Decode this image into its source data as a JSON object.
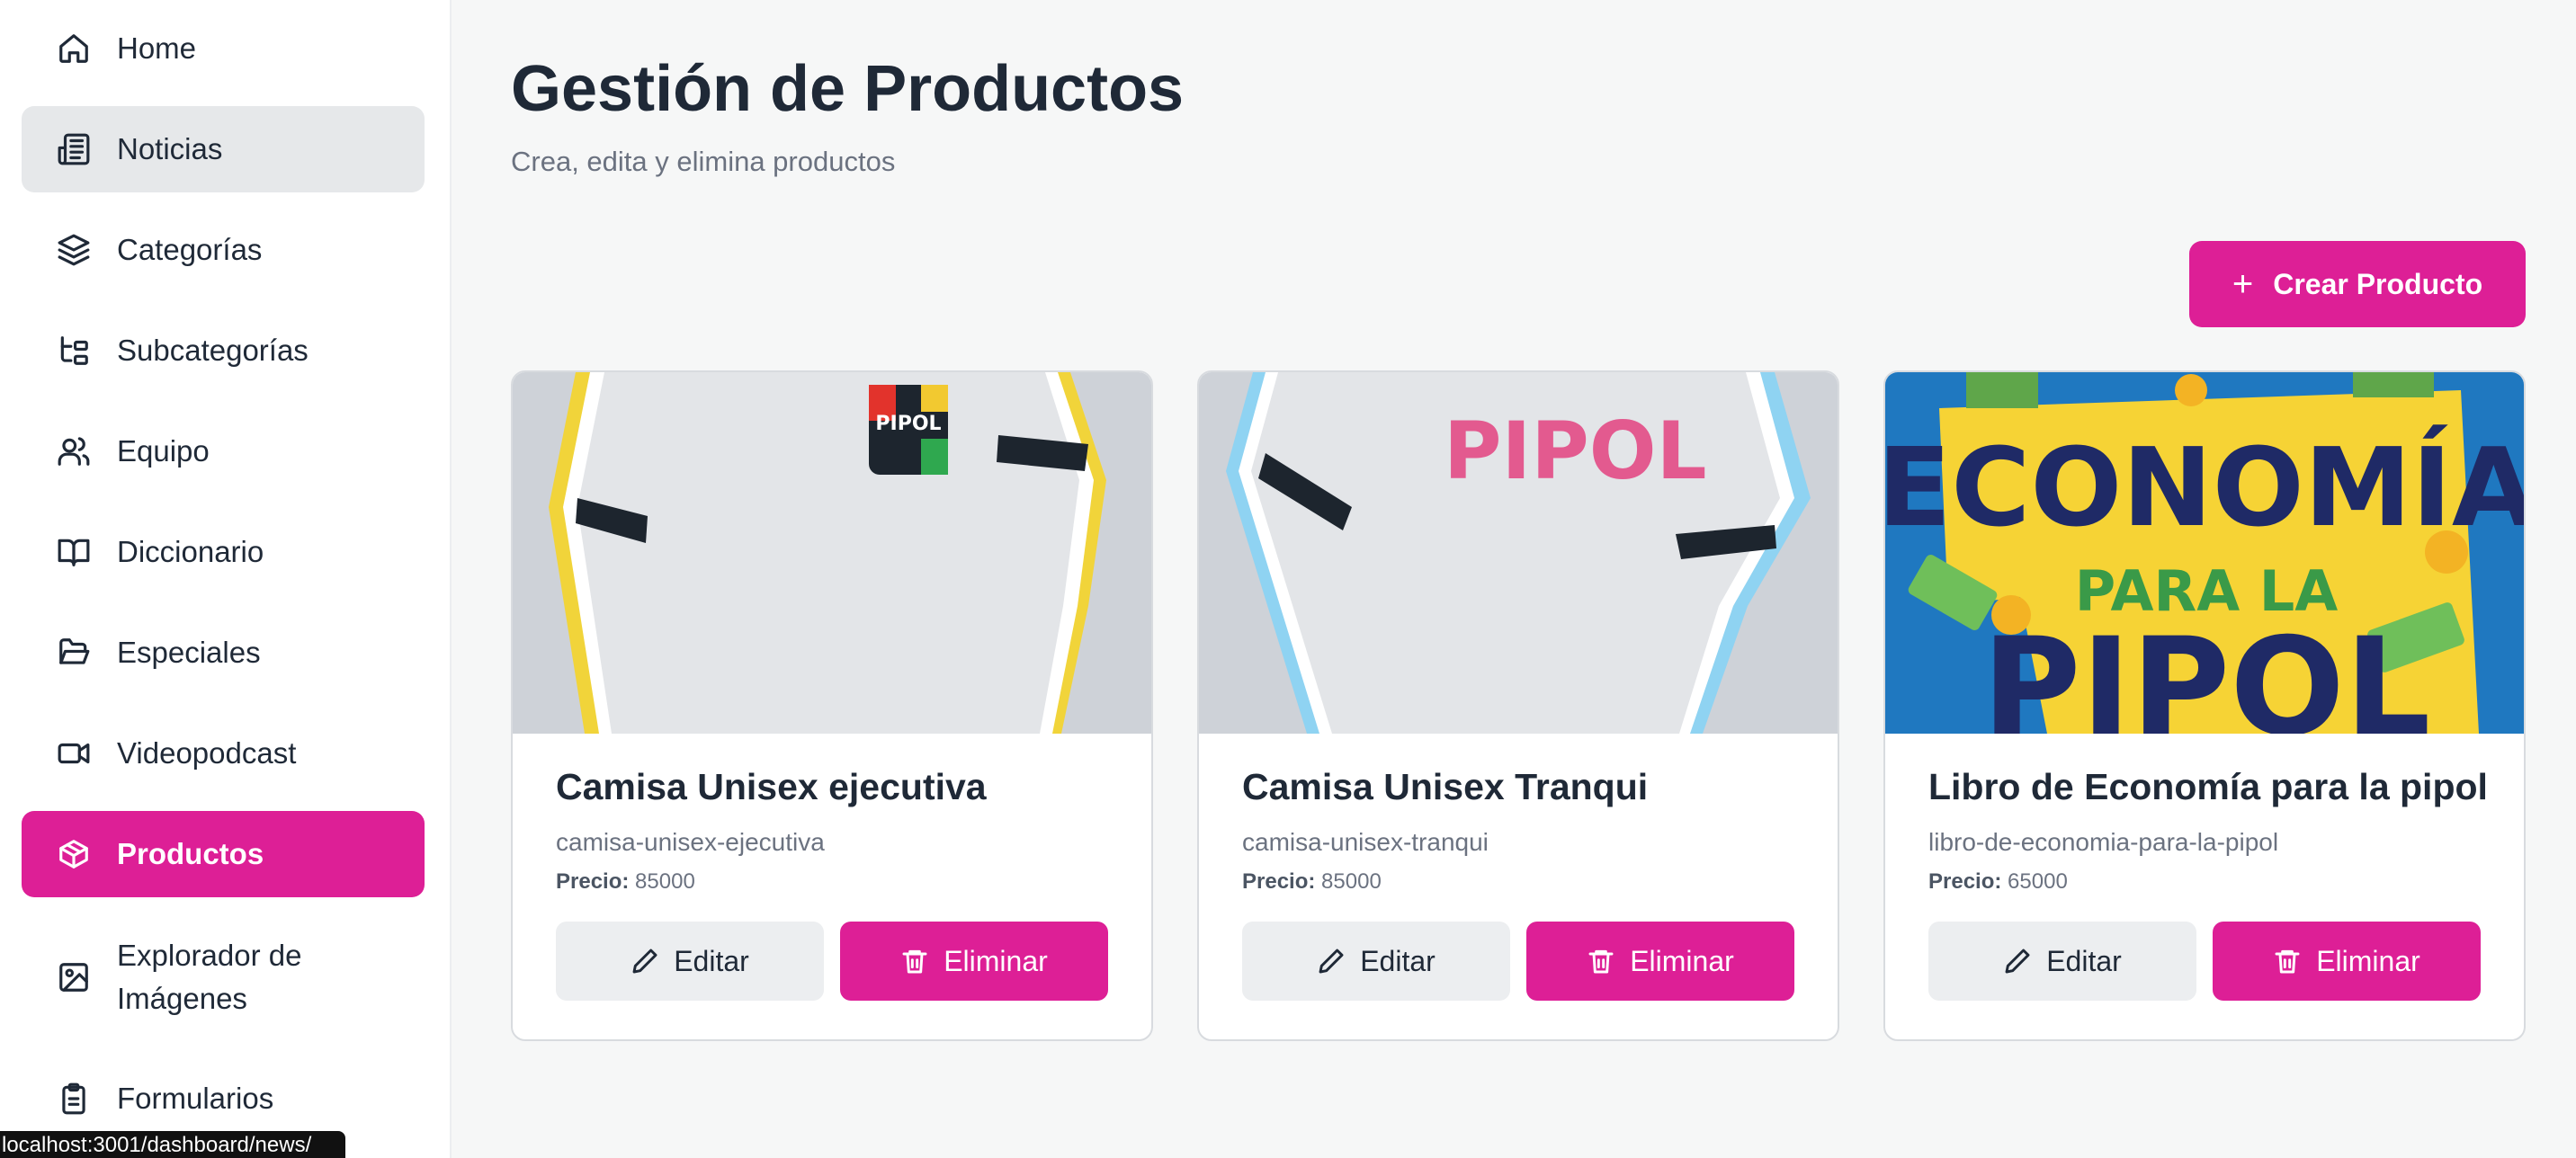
{
  "sidebar": {
    "items": [
      {
        "label": "Home",
        "icon": "home-icon"
      },
      {
        "label": "Noticias",
        "icon": "newspaper-icon"
      },
      {
        "label": "Categorías",
        "icon": "layers-icon"
      },
      {
        "label": "Subcategorías",
        "icon": "folder-tree-icon"
      },
      {
        "label": "Equipo",
        "icon": "users-icon"
      },
      {
        "label": "Diccionario",
        "icon": "book-icon"
      },
      {
        "label": "Especiales",
        "icon": "folder-open-icon"
      },
      {
        "label": "Videopodcast",
        "icon": "video-icon"
      },
      {
        "label": "Productos",
        "icon": "package-icon"
      },
      {
        "label": "Explorador de Imágenes",
        "icon": "image-icon"
      },
      {
        "label": "Formularios",
        "icon": "clipboard-icon"
      }
    ]
  },
  "status_bar": {
    "url": "localhost:3001/dashboard/news/"
  },
  "header": {
    "title": "Gestión de Productos",
    "subtitle": "Crea, edita y elimina productos"
  },
  "toolbar": {
    "create_label": "Crear Producto"
  },
  "products": [
    {
      "title": "Camisa Unisex ejecutiva",
      "slug": "camisa-unisex-ejecutiva",
      "price_label": "Precio:",
      "price": "85000",
      "edit_label": "Editar",
      "delete_label": "Eliminar",
      "image_text": "PIPOL"
    },
    {
      "title": "Camisa Unisex Tranqui",
      "slug": "camisa-unisex-tranqui",
      "price_label": "Precio:",
      "price": "85000",
      "edit_label": "Editar",
      "delete_label": "Eliminar",
      "image_text": "PIPOL"
    },
    {
      "title": "Libro de Economía para la pipol",
      "slug": "libro-de-economia-para-la-pipol",
      "price_label": "Precio:",
      "price": "65000",
      "edit_label": "Editar",
      "delete_label": "Eliminar",
      "image_text_1": "ECONOMÍA",
      "image_text_2": "PARA LA",
      "image_text_3": "PIPOL"
    }
  ],
  "colors": {
    "accent": "#dd1f96",
    "background": "#f6f7f7",
    "text": "#1f2937",
    "muted": "#6b7280"
  }
}
